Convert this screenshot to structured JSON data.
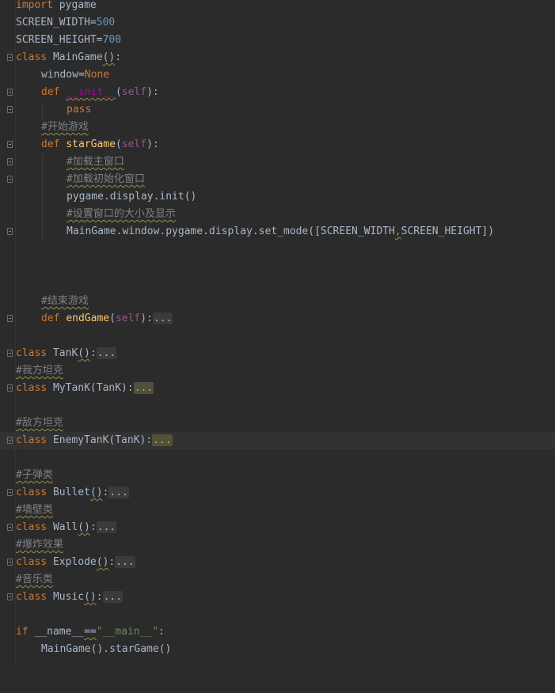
{
  "editor": {
    "lines": {
      "l1": {
        "kw": "import",
        "rest": " pygame"
      },
      "l2": {
        "name": "SCREEN_WIDTH",
        "eq": "=",
        "val": "500"
      },
      "l3": {
        "name": "SCREEN_HEIGHT",
        "eq": "=",
        "val": "700"
      },
      "l4": {
        "kw": "class",
        "name": " MainGame",
        "paren": "()",
        ":": ":"
      },
      "l5": {
        "name": "window",
        "eq": "=",
        "val": "None"
      },
      "l6": {
        "kw": "def",
        "sp": " ",
        "fn": "__init__",
        "p1": "(",
        "self": "self",
        "p2": "):"
      },
      "l7": {
        "kw": "pass"
      },
      "l8": {
        "cmt": "#开始游戏"
      },
      "l9": {
        "kw": "def",
        "sp": " ",
        "fn": "starGame",
        "p1": "(",
        "self": "self",
        "p2": "):"
      },
      "l10": {
        "cmt": "#加载主窗口"
      },
      "l11": {
        "cmt": "#加载初始化窗口"
      },
      "l12": {
        "text": "pygame.display.init()"
      },
      "l13": {
        "cmt": "#设置窗口的大小及显示"
      },
      "l14": {
        "a": "MainGame.window.pygame.display.set_mode([SCREEN_WIDTH",
        "comma": ",",
        "b": "SCREEN_HEIGHT])"
      },
      "l18": {
        "cmt": "#结束游戏"
      },
      "l19": {
        "kw": "def",
        "sp": " ",
        "fn": "endGame",
        "p1": "(",
        "self": "self",
        "p2": "):",
        "fold": "..."
      },
      "l21": {
        "kw": "class",
        "name": " TanK",
        "paren": "()",
        ":": ":",
        "fold": "..."
      },
      "l22": {
        "cmt": "#我方坦克"
      },
      "l23": {
        "kw": "class",
        "name": " MyTanK(TanK):",
        "fold": "..."
      },
      "l25": {
        "cmt": "#敌方坦克"
      },
      "l26": {
        "kw": "class",
        "name": " EnemyTanK(TanK):",
        "fold": "..."
      },
      "l28": {
        "cmt": "#子弹类"
      },
      "l29": {
        "kw": "class",
        "name": " Bullet",
        "paren": "()",
        ":": ":",
        "fold": "..."
      },
      "l30": {
        "cmt": "#墙壁类"
      },
      "l31": {
        "kw": "class",
        "name": " Wall",
        "paren": "()",
        ":": ":",
        "fold": "..."
      },
      "l32": {
        "cmt": "#爆炸效果"
      },
      "l33": {
        "kw": "class",
        "name": " Explode",
        "paren": "()",
        ":": ":",
        "fold": "..."
      },
      "l34": {
        "cmt": "#音乐类"
      },
      "l35": {
        "kw": "class",
        "name": " Music",
        "paren": "()",
        ":": ":",
        "fold": "..."
      },
      "l37": {
        "kw": "if",
        "a": " __name__",
        "eq": "==",
        "str": "\"__main__\"",
        "c": ":"
      },
      "l38": {
        "text": "MainGame().starGame()"
      }
    }
  }
}
